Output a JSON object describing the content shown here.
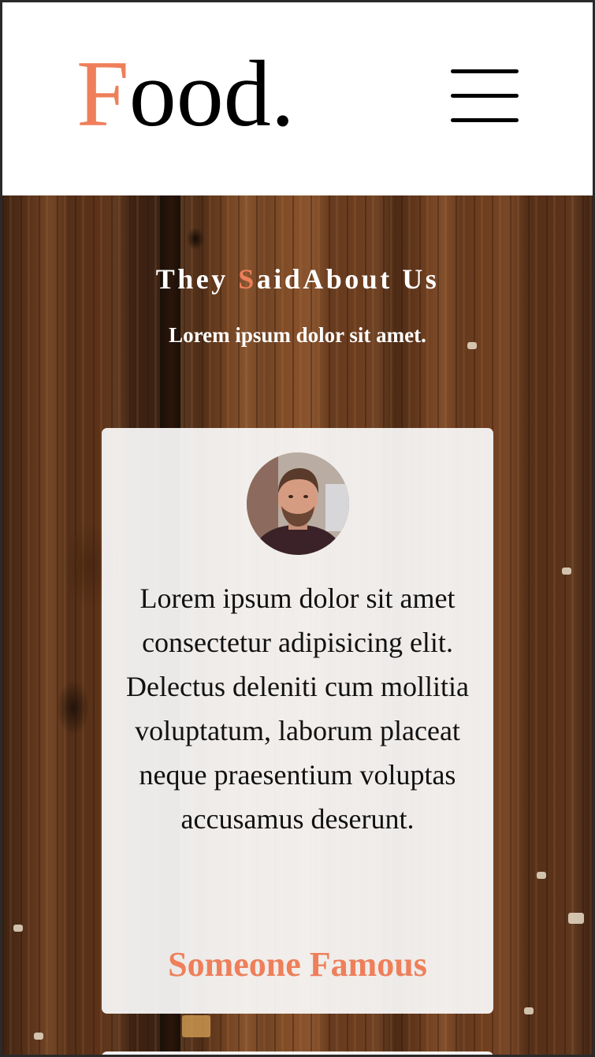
{
  "header": {
    "logo_first": "F",
    "logo_rest": "ood.",
    "menu_icon": "hamburger-menu-icon"
  },
  "testimonials": {
    "title_part1": "They ",
    "title_accent": "S",
    "title_part2": "aidAbout Us",
    "subtitle": "Lorem ipsum dolor sit amet.",
    "card": {
      "quote": "Lorem ipsum dolor sit amet consectetur adipisicing elit. Delectus deleniti cum mollitia voluptatum, laborum placeat neque praesentium voluptas accusamus deserunt.",
      "author": "Someone Famous"
    }
  },
  "colors": {
    "accent": "#ee7f5a",
    "header_bg": "#ffffff",
    "text": "#000000"
  }
}
